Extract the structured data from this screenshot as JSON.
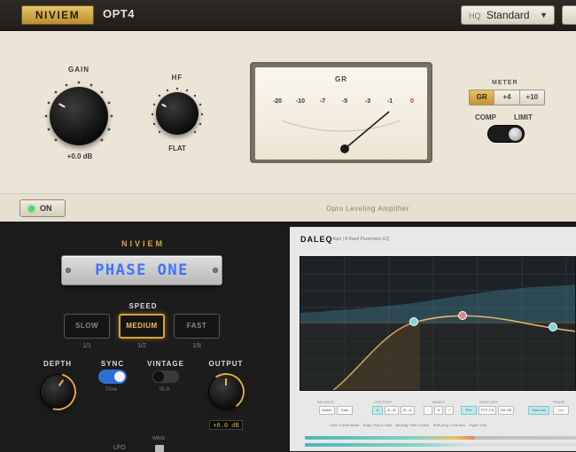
{
  "opt4": {
    "brand": "NIVIEM",
    "product": "OPT4",
    "preset": {
      "hq": "HQ",
      "value": "Standard"
    },
    "gain": {
      "label": "GAIN",
      "value": "+0.0 dB"
    },
    "hf": {
      "label": "HF",
      "value": "FLAT"
    },
    "gr_meter": {
      "title": "GR",
      "scale": [
        "-20",
        "-10",
        "-7",
        "-5",
        "-3",
        "-1",
        "0"
      ]
    },
    "meter": {
      "label": "METER",
      "options": [
        "GR",
        "+4",
        "+10"
      ],
      "selected": "GR"
    },
    "mode": {
      "comp": "COMP",
      "limit": "LIMIT"
    },
    "power": "ON",
    "tagline": "Opto Leveling Amplifier"
  },
  "phase_one": {
    "brand": "NIVIEM",
    "title": "PHASE ONE",
    "speed": {
      "label": "SPEED",
      "options": [
        {
          "label": "SLOW",
          "sub": "1/1"
        },
        {
          "label": "MEDIUM",
          "sub": "1/2"
        },
        {
          "label": "FAST",
          "sub": "1/8"
        }
      ],
      "selected": "MEDIUM"
    },
    "depth_label": "DEPTH",
    "sync": {
      "label": "SYNC",
      "sub": "Time"
    },
    "vintage": {
      "label": "VINTAGE",
      "sub": "IS-9"
    },
    "output": {
      "label": "OUTPUT",
      "value": "+0.0 dB"
    },
    "lfo": "LFO",
    "wave": "WAVE"
  },
  "daleq": {
    "title": "DALEQ",
    "subtitle": "Auto | 8 Band Parametric EQ",
    "groups": [
      "BALANCE",
      "CONTOUR",
      "BANDS",
      "ANALYZER",
      "PHASE"
    ],
    "controls": {
      "balance": [
        "Match",
        "Gain"
      ],
      "contour": [
        "A",
        "A→B",
        "B→A"
      ],
      "bands": [
        "-",
        "8",
        "+"
      ],
      "analyzer": [
        "Pre",
        "FFT 2.5",
        "1/6 OB"
      ],
      "phase": [
        "Zero Lat",
        "Lin"
      ]
    },
    "status": [
      "Cmd: Create Band",
      "Drag: Freq & Gain",
      "Alt-drag: Fine Control",
      "Shift-drag: Lock Axis",
      "Right: Solo"
    ],
    "colors": {
      "curve": "#e8b36a",
      "node1": "#7fd6d0",
      "node2": "#e98383",
      "node3": "#7fd6d0"
    }
  }
}
